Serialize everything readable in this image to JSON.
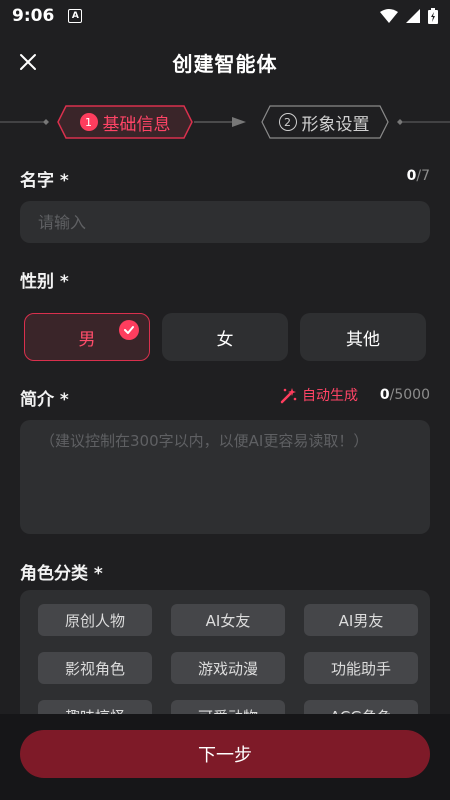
{
  "status_bar": {
    "time": "9:06",
    "a_icon": "A"
  },
  "header": {
    "title": "创建智能体",
    "close_icon": "close-icon"
  },
  "stepper": {
    "steps": [
      {
        "number": "1",
        "label": "基础信息",
        "active": true
      },
      {
        "number": "2",
        "label": "形象设置",
        "active": false
      }
    ]
  },
  "name_section": {
    "label": "名字 *",
    "count": "0",
    "max": "/7",
    "placeholder": "请输入"
  },
  "gender_section": {
    "label": "性别 *",
    "options": [
      "男",
      "女",
      "其他"
    ],
    "selected": "男"
  },
  "intro_section": {
    "label": "简介 *",
    "auto_generate": "自动生成",
    "count": "0",
    "max": "/5000",
    "placeholder": "（建议控制在300字以内，以便AI更容易读取！）"
  },
  "category_section": {
    "label": "角色分类 *",
    "items": [
      "原创人物",
      "AI女友",
      "AI男友",
      "影视角色",
      "游戏动漫",
      "功能助手",
      "趣味搞怪",
      "可爱动物",
      "ACG角色"
    ]
  },
  "footer": {
    "next_label": "下一步"
  },
  "colors": {
    "background": "#1f1f21",
    "accent": "#ff3d5e",
    "next_button": "#7e1a28",
    "field": "#2e2f31"
  }
}
